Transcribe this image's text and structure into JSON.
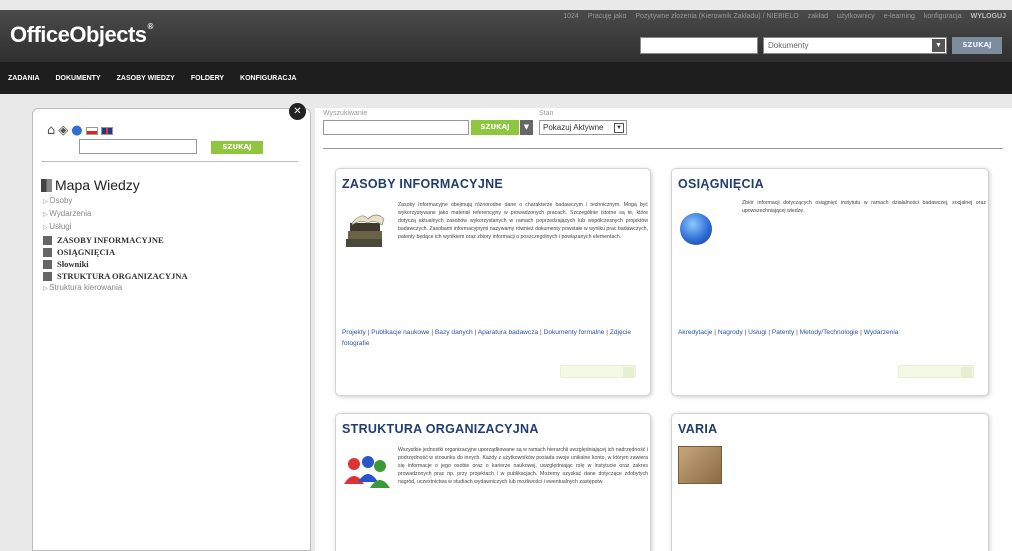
{
  "header": {
    "logo": "OfficeObjects",
    "logo_mark": "®",
    "top_menu": [
      "1024",
      "Pracuję jako",
      "Pozytywne złożenia (Kierownik Zakładu) / NIEBIELO",
      "zakład",
      "użytkownicy",
      "e-learning",
      "konfiguracja",
      "WYLOGUJ"
    ],
    "search_placeholder": "",
    "type_select": "Dokumenty",
    "search_button": "SZUKAJ"
  },
  "nav": {
    "items": [
      "ZADANIA",
      "DOKUMENTY",
      "ZASOBY WIEDZY",
      "FOLDERY",
      "KONFIGURACJA"
    ]
  },
  "left": {
    "search_button": "SZUKAJ",
    "tree_title": "Mapa Wiedzy",
    "subs": [
      "Osoby",
      "Wydarzenia",
      "Usługi"
    ],
    "mains": [
      "ZASOBY INFORMACYJNE",
      "OSIĄGNIĘCIA",
      "Słowniki",
      "STRUKTURA ORGANIZACYJNA"
    ],
    "sub_last": "Struktura kierowania"
  },
  "filter": {
    "search_label": "Wyszukiwanie",
    "search_button": "SZUKAJ",
    "status_label": "Stan",
    "status_value": "Pokazuj Aktywne"
  },
  "cards": {
    "zasoby": {
      "title": "ZASOBY INFORMACYJNE",
      "desc": "Zasoby Informacyjne obejmują różnorodne dane o charakterze badawczym i technicznym. Mogą być wykorzystywane jako materiał referencyjny w prowadzonych pracach. Szczególnie istotne są te, które dotyczą aktualnych zasobów wykorzystanych w ramach poprzedzających lub współczesnych projektów badawczych. Zasobami informacyjnymi nazywamy również dokumenty powstałe w wyniku prac badawczych, patenty będące ich wynikiem oraz zbiory informacji o poszczególnych i powiązanych elementach.",
      "links": [
        "Projekty",
        "Publikacje naukowe",
        "Bazy danych",
        "Aparatura badawcza",
        "Dokumenty formalne",
        "Zdjęcie fotografie"
      ]
    },
    "osiagniecia": {
      "title": "OSIĄGNIĘCIA",
      "desc": "Zbiór informacji dotyczących osiągnięć instytutu w ramach działalności badawczej, socjalnej oraz upowszechniającej wiedzę.",
      "links": [
        "Akredytacje",
        "Nagrody",
        "Usługi",
        "Patenty",
        "Metody/Technologie",
        "Wydarzenia"
      ]
    },
    "struktura": {
      "title": "STRUKTURA ORGANIZACYJNA",
      "desc": "Wszystkie jednostki organizacyjne uporządkowane są w ramach hierarchii uwzględniającej ich nadrzędność i podrzędność w stosunku do innych. Każdy z użytkowników posiada swoje unikalne konto, w którym zawiera się informacje o jego osobie oraz o karierze naukowej, uwzględniając rolę w instytucie oraz zakres prowadzonych prac np. przy projektach i w publikacjach. Możemy uzyskać dane dotyczące zdobytych nagród, uczestnictwa w studiach wydawniczych lub możliwości i ewentualnych zastępstw."
    },
    "varia": {
      "title": "VARIA"
    }
  }
}
